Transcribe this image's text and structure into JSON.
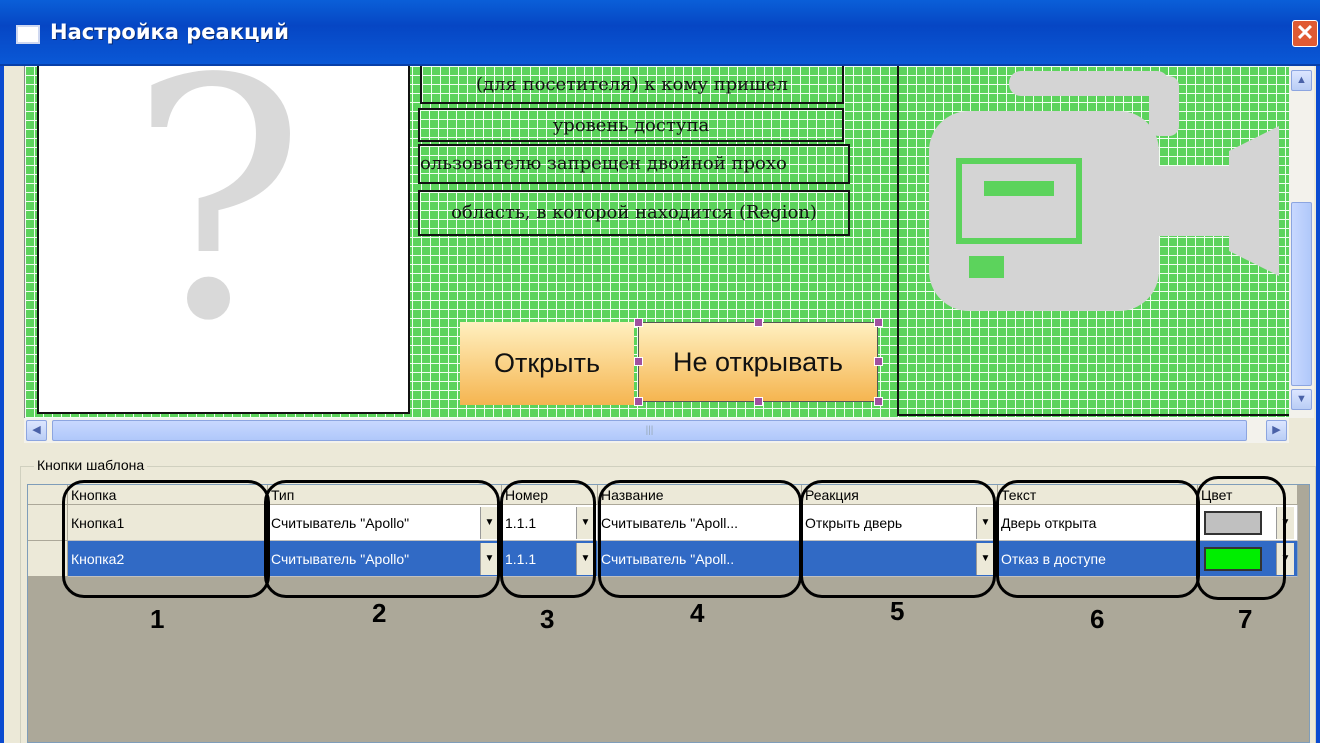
{
  "window": {
    "title": "Настройка реакций",
    "close_glyph": "✕"
  },
  "template": {
    "photo_placeholder": "?",
    "text_fields": [
      "(для посетителя) к кому пришел",
      "уровень доступа",
      "ользователю запрещен двойной прохо",
      "область, в которой находится (Region)"
    ],
    "button_open": "Открыть",
    "button_no": "Не открывать",
    "camera_icon": "video-camera-icon"
  },
  "groupbox": {
    "label": "Кнопки шаблона"
  },
  "grid": {
    "headers": [
      "Кнопка",
      "Тип",
      "Номер",
      "Название",
      "Реакция",
      "Текст",
      "Цвет"
    ],
    "rows": [
      {
        "button": "Кнопка1",
        "type": "Считыватель \"Apollo\"",
        "number": "1.1.1",
        "name": "Считыватель \"Apoll...",
        "reaction": "Открыть дверь",
        "text": "Дверь открыта",
        "color": "#c0c0c0"
      },
      {
        "button": "Кнопка2",
        "type": "Считыватель \"Apollo\"",
        "number": "1.1.1",
        "name": "Считыватель \"Apoll..",
        "reaction": "",
        "text": "Отказ в доступе",
        "color": "#00ee00"
      }
    ]
  },
  "callouts": [
    "1",
    "2",
    "3",
    "4",
    "5",
    "6",
    "7"
  ],
  "colors": {
    "titlebar": "#0a5fd8",
    "selection": "#316ac5",
    "canvas": "#5cd35c",
    "button_gradient": "#f5b550"
  }
}
